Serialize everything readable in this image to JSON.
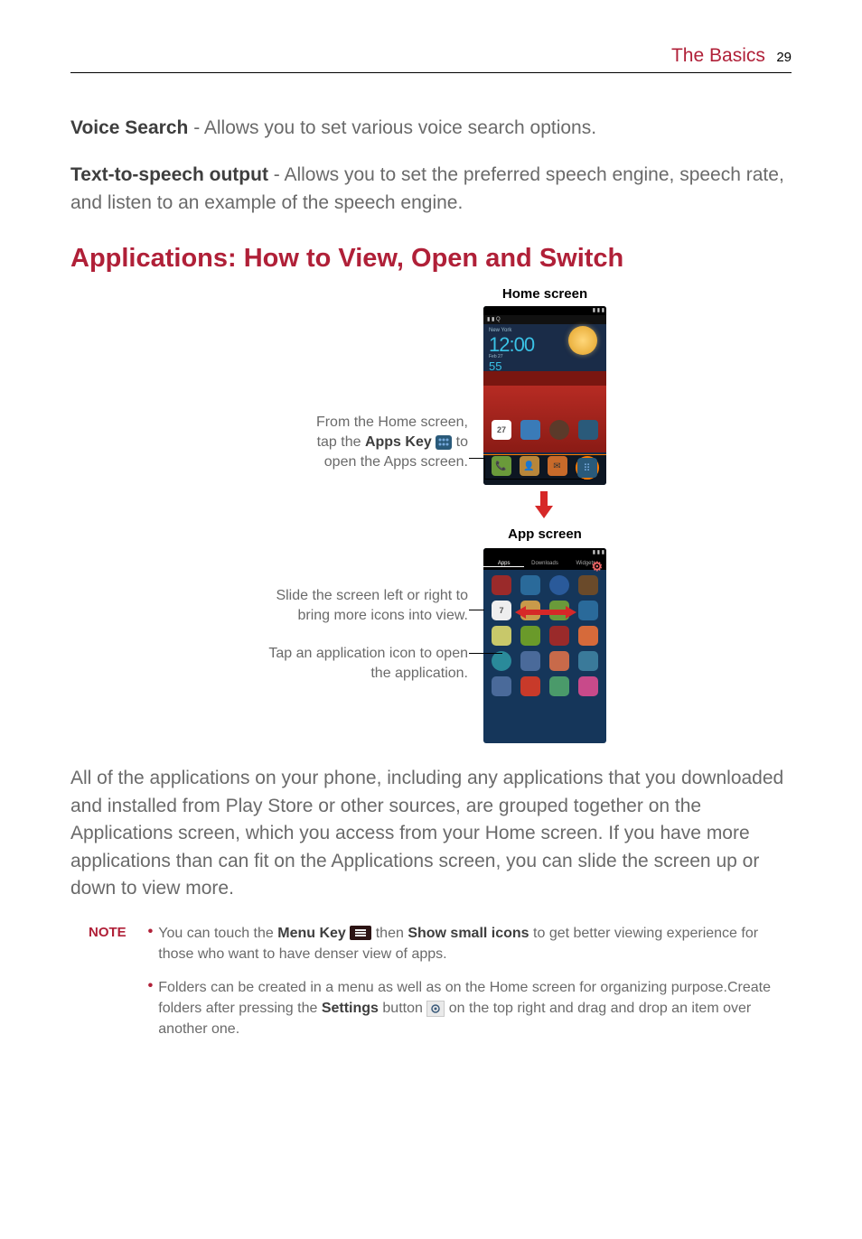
{
  "header": {
    "section_title": "The Basics",
    "page_number": "29"
  },
  "intro": {
    "voice_search_label": "Voice Search",
    "voice_search_desc": " - Allows you to set various voice search options.",
    "tts_label": "Text-to-speech output",
    "tts_desc": " - Allows you to set the preferred speech engine, speech rate, and listen to an example of the speech engine."
  },
  "heading": "Applications: How to View, Open and Switch",
  "figure": {
    "home_screen_label": "Home screen",
    "app_screen_label": "App screen",
    "callout1_line1": "From the Home screen,",
    "callout1_line2a": "tap the ",
    "callout1_apps_key": "Apps Key",
    "callout1_line2b": " to",
    "callout1_line3": "open the Apps screen.",
    "callout2_line1": "Slide the screen left or right to",
    "callout2_line2": "bring more icons into view.",
    "callout3_line1": "Tap an application icon to open",
    "callout3_line2": "the application.",
    "home_clock": "12:00",
    "home_temp": "55",
    "home_cal_day": "27"
  },
  "main_paragraph": "All of the applications on your phone, including any applications that you downloaded and installed from Play Store or other sources, are grouped together on the Applications screen, which you access from your Home screen. If you have more applications than can fit on the Applications screen, you can slide the screen up or down to view more.",
  "notes": {
    "label": "NOTE",
    "item1_pre": "You can touch the ",
    "item1_menu_key": "Menu Key",
    "item1_mid": " then ",
    "item1_show_small": "Show small icons",
    "item1_post": " to get better viewing experience for those who want to have denser view of apps.",
    "item2_pre": "Folders can be created in a menu as well as on the Home screen for organizing purpose.Create folders after pressing the ",
    "item2_settings": "Settings",
    "item2_mid": " button ",
    "item2_post": " on the top right and drag and drop an item over another one."
  }
}
